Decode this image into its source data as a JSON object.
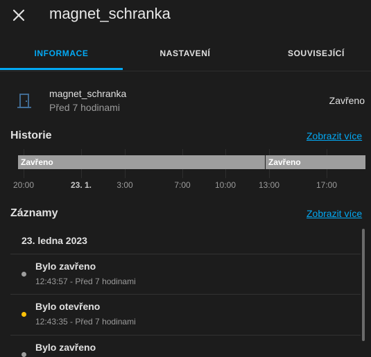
{
  "header": {
    "title": "magnet_schranka",
    "close_icon": "close-icon"
  },
  "tabs": [
    {
      "label": "INFORMACE",
      "active": true
    },
    {
      "label": "NASTAVENÍ",
      "active": false
    },
    {
      "label": "SOUVISEJÍCÍ",
      "active": false
    }
  ],
  "entity": {
    "icon": "door-icon",
    "name": "magnet_schranka",
    "last_changed": "Před 7 hodinami",
    "state": "Zavřeno"
  },
  "history": {
    "title": "Historie",
    "more_link": "Zobrazit více",
    "segments": [
      {
        "label": "Zavřeno",
        "color": "#9e9e9e"
      },
      {
        "label": "Zavřeno",
        "color": "#9e9e9e"
      }
    ],
    "ticks": [
      "20:00",
      "23. 1.",
      "3:00",
      "7:00",
      "10:00",
      "13:00",
      "17:00"
    ]
  },
  "logbook": {
    "title": "Záznamy",
    "more_link": "Zobrazit více",
    "date": "23. ledna 2023",
    "entries": [
      {
        "title": "Bylo zavřeno",
        "time": "12:43:57 - Před 7 hodinami",
        "dot_color": "#9e9e9e"
      },
      {
        "title": "Bylo otevřeno",
        "time": "12:43:35 - Před 7 hodinami",
        "dot_color": "#ffc107"
      },
      {
        "title": "Bylo zavřeno",
        "time": "",
        "dot_color": "#9e9e9e"
      }
    ]
  },
  "colors": {
    "accent": "#03a9f4",
    "background": "#1c1c1c",
    "closed": "#9e9e9e",
    "open": "#ffc107"
  }
}
